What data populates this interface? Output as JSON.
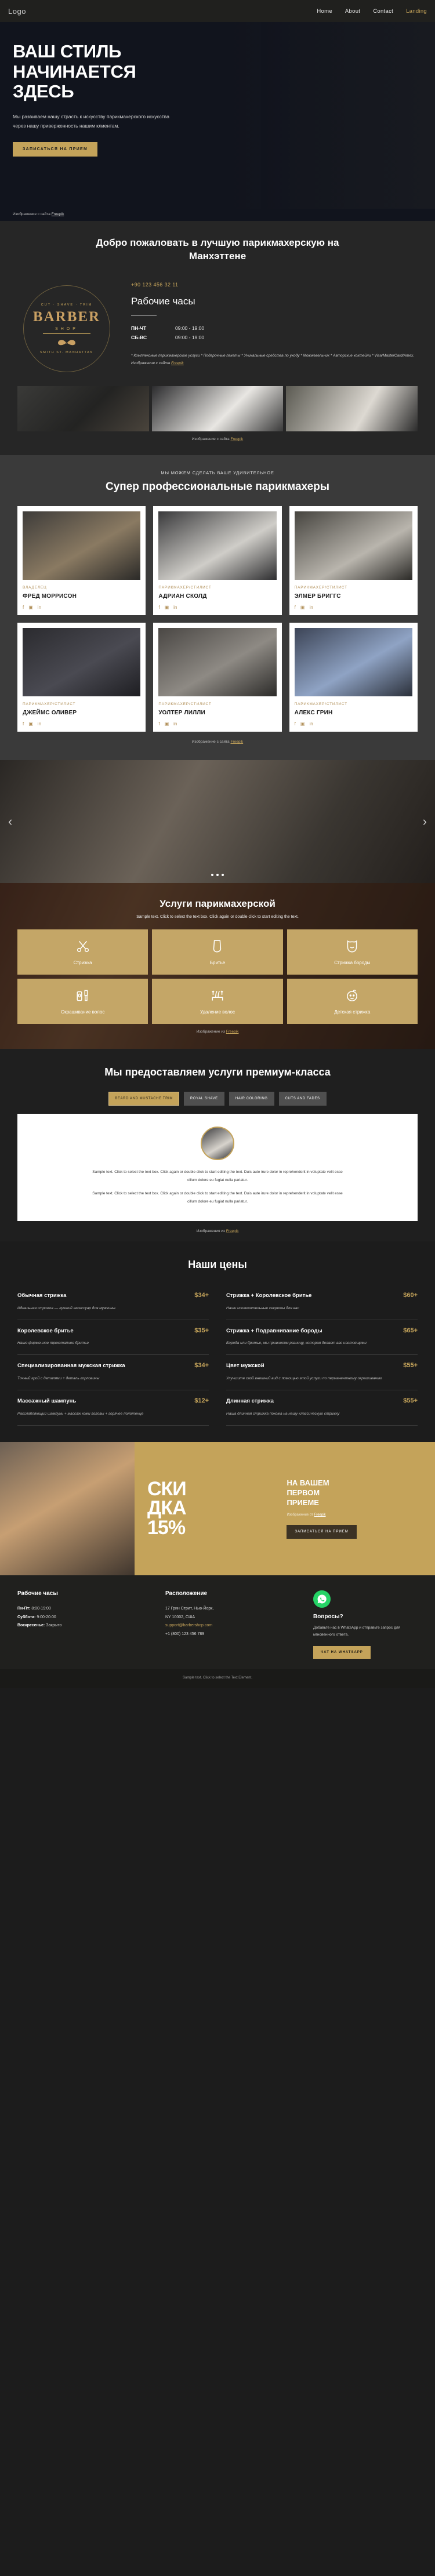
{
  "nav": {
    "logo": "Logo",
    "links": [
      {
        "label": "Home",
        "active": false
      },
      {
        "label": "About",
        "active": false
      },
      {
        "label": "Contact",
        "active": false
      },
      {
        "label": "Landing",
        "active": true
      }
    ]
  },
  "hero": {
    "title_line1": "ВАШ СТИЛЬ",
    "title_line2": "НАЧИНАЕТСЯ",
    "title_line3": "ЗДЕСЬ",
    "description": "Мы развиваем нашу страсть к искусству парикмахерского искусства через нашу приверженность нашим клиентам.",
    "cta": "ЗАПИСАТЬСЯ НА ПРИЕМ",
    "credit_prefix": "Изображение с сайта ",
    "credit_link": "Freepik"
  },
  "welcome": {
    "heading": "Добро пожаловать в лучшую парикмахерскую на Манхэттене",
    "logo": {
      "arc_top": "CUT · SHAVE · TRIM",
      "main": "BARBER",
      "shop": "SHOP",
      "arc_bottom": "SMITH ST. MANHATTAN",
      "mustache": "〰"
    },
    "phone": "+90 123 456 32 11",
    "hours_title": "Рабочие часы",
    "hours": [
      {
        "day": "ПН-ЧТ",
        "value": "09:00 - 19:00"
      },
      {
        "day": "СБ-ВС",
        "value": "09:00 - 19:00"
      }
    ],
    "fineprint": "* Комплексные парикмахерские услуги * Подарочные пакеты * Уникальные средства по уходу * Можжевельник * Авторские коктейли * Visa/MasterCard/Amex. Изображения с сайта ",
    "fineprint_link": "Freepik",
    "gallery_credit_prefix": "Изображение с сайта ",
    "gallery_credit_link": "Freepik"
  },
  "team": {
    "eyebrow": "МЫ МОЖЕМ СДЕЛАТЬ ВАШЕ УДИВИТЕЛЬНОЕ",
    "heading": "Супер профессиональные парикмахеры",
    "members": [
      {
        "role": "ВЛАДЕЛЕЦ",
        "name": "ФРЕД МОРРИСОН"
      },
      {
        "role": "ПАРИКМАХЕР/СТИЛИСТ",
        "name": "АДРИАН СКОЛД"
      },
      {
        "role": "ПАРИКМАХЕР/СТИЛИСТ",
        "name": "ЭЛМЕР БРИГГС"
      },
      {
        "role": "ПАРИКМАХЕР/СТИЛИСТ",
        "name": "ДЖЕЙМС ОЛИВЕР"
      },
      {
        "role": "ПАРИКМАХЕР/СТИЛИСТ",
        "name": "УОЛТЕР ЛИЛЛИ"
      },
      {
        "role": "ПАРИКМАХЕР/СТИЛИСТ",
        "name": "АЛЕКС ГРИН"
      }
    ],
    "social_icons": [
      "facebook-icon",
      "instagram-icon",
      "linkedin-icon"
    ],
    "credit_prefix": "Изображение с сайта ",
    "credit_link": "Freepik"
  },
  "slider": {
    "prev": "‹",
    "next": "›",
    "dots": 3
  },
  "services": {
    "heading": "Услуги парикмахерской",
    "subtitle": "Sample text. Click to select the text box. Click again or double click to start editing the text.",
    "items": [
      {
        "label": "Стрижка",
        "icon": "scissors-icon"
      },
      {
        "label": "Бритье",
        "icon": "razor-icon"
      },
      {
        "label": "Стрижка бороды",
        "icon": "beard-icon"
      },
      {
        "label": "Окрашивание волос",
        "icon": "hair-dye-icon"
      },
      {
        "label": "Удаление волос",
        "icon": "hair-removal-icon"
      },
      {
        "label": "Детская стрижка",
        "icon": "baby-icon"
      }
    ],
    "credit_prefix": "Изображение из ",
    "credit_link": "Freepik"
  },
  "premium": {
    "heading": "Мы предоставляем услуги премиум-класса",
    "tabs": [
      {
        "label": "BEARD AND MUSTACHE TRIM",
        "active": true
      },
      {
        "label": "ROYAL SHAVE",
        "active": false
      },
      {
        "label": "HAIR COLORING",
        "active": false
      },
      {
        "label": "CUTS AND FADES",
        "active": false
      }
    ],
    "panel": {
      "paragraph1": "Sample text. Click to select the text box. Click again or double click to start editing the text. Duis aute irure dolor in reprehenderit in voluptate velit esse cillum dolore eu fugiat nulla pariatur.",
      "paragraph2": "Sample text. Click to select the text box. Click again or double click to start editing the text. Duis aute irure dolor in reprehenderit in voluptate velit esse cillum dolore eu fugiat nulla pariatur."
    },
    "credit_prefix": "Изображения из ",
    "credit_link": "Freepik"
  },
  "prices": {
    "heading": "Наши цены",
    "items": [
      {
        "name": "Обычная стрижка",
        "price": "$34+",
        "desc": "Идеальная стрижка — лучший аксессуар для мужчины."
      },
      {
        "name": "Стрижка + Королевское бритье",
        "price": "$60+",
        "desc": "Наши исключительные секреты для вас"
      },
      {
        "name": "Королевское бритье",
        "price": "$35+",
        "desc": "Наше фирменное трехэтапное бритье"
      },
      {
        "name": "Стрижка + Подравнивание бороды",
        "price": "$65+",
        "desc": "Борода или бритье, мы привносим разницу, которая делает вас настоящими"
      },
      {
        "name": "Специализированная мужская стрижка",
        "price": "$34+",
        "desc": "Точный крой с деталями + деталь горловины"
      },
      {
        "name": "Цвет мужской",
        "price": "$55+",
        "desc": "Улучшите свой внешний вид с помощью этой услуги по перманентному окрашиванию"
      },
      {
        "name": "Массажный шампунь",
        "price": "$12+",
        "desc": "Расслабляющий шампунь + массаж кожи головы + горячее полотенце"
      },
      {
        "name": "Длинная стрижка",
        "price": "$55+",
        "desc": "Наша длинная стрижка похожа на нашу классическую стрижку"
      }
    ]
  },
  "promo": {
    "discount_line1": "СКИ",
    "discount_line2": "ДКА",
    "discount_line3": "15%",
    "head_line1": "НА ВАШЕМ",
    "head_line2": "ПЕРВОМ",
    "head_line3": "ПРИЕМЕ",
    "credit_prefix": "Изображение от ",
    "credit_link": "Freepik",
    "cta": "ЗАПИСАТЬСЯ НА ПРИЕМ"
  },
  "footer": {
    "hours": {
      "title": "Рабочие часы",
      "lines": [
        {
          "label": "Пн-Пт:",
          "value": "8:00-19:00"
        },
        {
          "label": "Суббота:",
          "value": "9:00-20:00"
        },
        {
          "label": "Воскресенье:",
          "value": "Закрыто"
        }
      ]
    },
    "location": {
      "title": "Расположение",
      "address_line1": "17 Грин Стрит, Нью-Йорк,",
      "address_line2": "NY 10002, США",
      "email": "support@barbershop.com",
      "phone": "+1 (800) 123 456 789"
    },
    "whatsapp": {
      "icon": "whatsapp-icon",
      "title": "Вопросы?",
      "text": "Добавьте нас в WhatsApp и отправьте запрос для мгновенного ответа.",
      "cta": "ЧАТ НА WHATSAPP"
    },
    "bottom": "Sample text. Click to select the Text Element."
  }
}
